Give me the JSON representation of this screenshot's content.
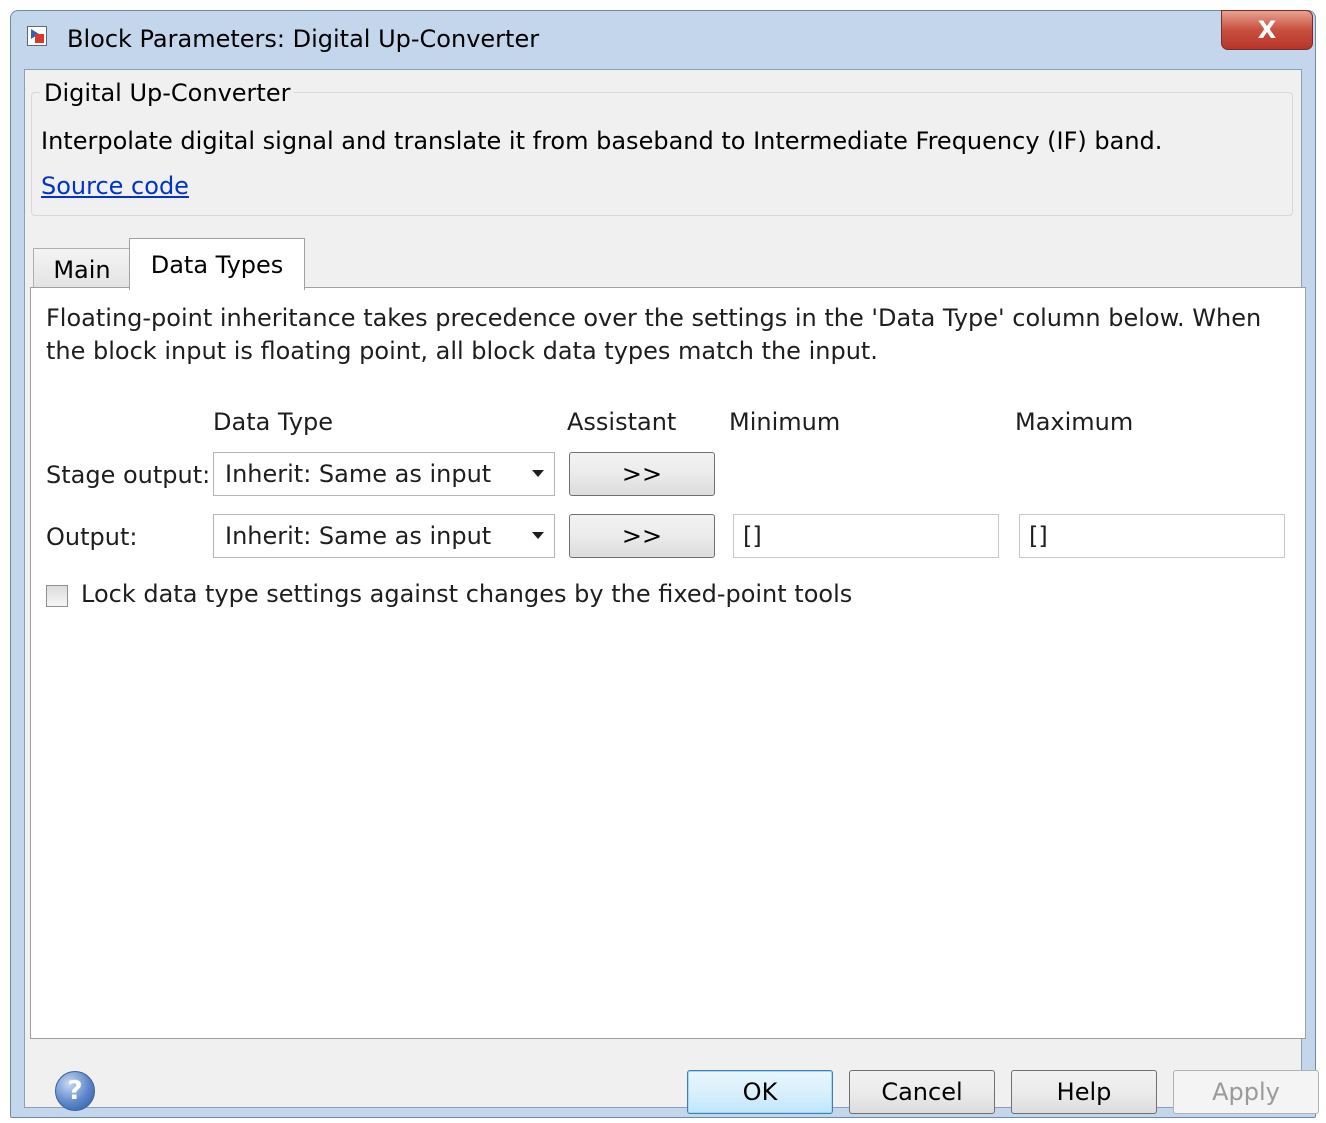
{
  "window": {
    "title": "Block Parameters: Digital Up-Converter",
    "close_glyph": "X"
  },
  "group": {
    "legend": "Digital Up-Converter",
    "description": "Interpolate digital signal and translate it from baseband to Intermediate Frequency (IF) band.",
    "link": "Source code"
  },
  "tabs": [
    {
      "label": "Main",
      "selected": false
    },
    {
      "label": "Data Types",
      "selected": true
    }
  ],
  "panel": {
    "description": "Floating-point inheritance takes precedence over the settings in the 'Data Type' column below. When the block input is floating point, all block data types match the input.",
    "headers": {
      "data_type": "Data Type",
      "assistant": "Assistant",
      "minimum": "Minimum",
      "maximum": "Maximum"
    },
    "rows": [
      {
        "label": "Stage output:",
        "data_type": "Inherit: Same as input",
        "assistant": ">>"
      },
      {
        "label": "Output:",
        "data_type": "Inherit: Same as input",
        "assistant": ">>",
        "minimum": "[]",
        "maximum": "[]"
      }
    ],
    "lock_checkbox": {
      "label": "Lock data type settings against changes by the fixed-point tools",
      "checked": false
    }
  },
  "buttons": {
    "help_icon": "?",
    "ok": "OK",
    "cancel": "Cancel",
    "help": "Help",
    "apply": "Apply"
  }
}
